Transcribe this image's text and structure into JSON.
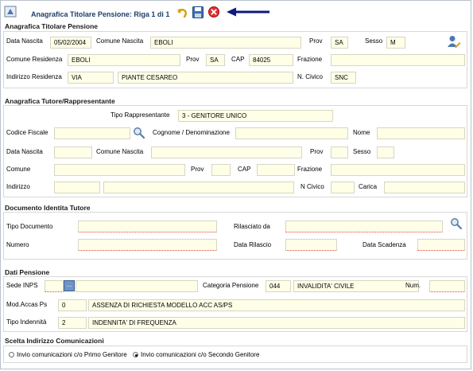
{
  "title": "Anagrafica Titolare Pensione: Riga 1 di 1",
  "toolbar": {
    "back_icon": "undo-arrow-icon",
    "save_icon": "floppy-disk-icon",
    "close_icon": "close-red-icon"
  },
  "titolare": {
    "section_title": "Anagrafica Titolare Pensione",
    "data_nascita_label": "Data Nascita",
    "data_nascita": "05/02/2004",
    "comune_nascita_label": "Comune Nascita",
    "comune_nascita": "EBOLI",
    "prov_label": "Prov",
    "prov": "SA",
    "sesso_label": "Sesso",
    "sesso": "M",
    "comune_residenza_label": "Comune Residenza",
    "comune_residenza": "EBOLI",
    "prov_res_label": "Prov",
    "prov_res": "SA",
    "cap_label": "CAP",
    "cap": "84025",
    "frazione_label": "Frazione",
    "frazione": "",
    "indirizzo_label": "Indirizzo Residenza",
    "indirizzo_tipo": "VIA",
    "indirizzo_nome": "PIANTE CESAREO",
    "civico_label": "N. Civico",
    "civico": "SNC"
  },
  "tutore": {
    "section_title": "Anagrafica Tutore/Rappresentante",
    "tipo_label": "Tipo Rappresentante",
    "tipo": "3 - GENITORE UNICO",
    "cf_label": "Codice Fiscale",
    "cognome_label": "Cognome / Denominazione",
    "nome_label": "Nome",
    "data_nascita_label": "Data Nascita",
    "comune_nascita_label": "Comune Nascita",
    "prov_label": "Prov",
    "sesso_label": "Sesso",
    "comune_label": "Comune",
    "prov2_label": "Prov",
    "cap_label": "CAP",
    "frazione_label": "Frazione",
    "indirizzo_label": "Indirizzo",
    "civico_label": "N Civico",
    "carica_label": "Carica"
  },
  "documento": {
    "section_title": "Documento Identita Tutore",
    "tipo_label": "Tipo Documento",
    "rilasciato_label": "Rilasciato da",
    "numero_label": "Numero",
    "data_rilascio_label": "Data Rilascio",
    "data_scadenza_label": "Data Scadenza"
  },
  "pensione": {
    "section_title": "Dati Pensione",
    "sede_label": "Sede INPS",
    "sede_button": "...",
    "categoria_label": "Categoria Pensione",
    "categoria_code": "044",
    "categoria_desc": "INVALIDITA' CIVILE",
    "num_label": "Num.",
    "mod_label": "Mod.Accas Ps",
    "mod_code": "0",
    "mod_desc": "ASSENZA DI RICHIESTA MODELLO ACC AS/PS",
    "indennita_label": "Tipo Indennità",
    "indennita_code": "2",
    "indennita_desc": "INDENNITA' DI FREQUENZA"
  },
  "comunicazioni": {
    "section_title": "Scelta Indirizzo Comunicazioni",
    "option1": "Invio comunicazioni c/o Primo Genitore",
    "option2": "Invio comunicazioni c/o Secondo Genitore",
    "selected": "option2"
  }
}
